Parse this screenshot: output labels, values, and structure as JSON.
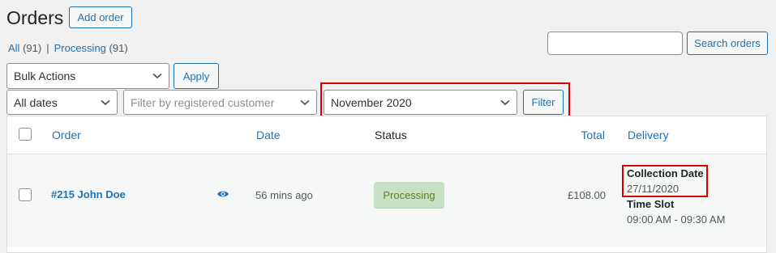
{
  "header": {
    "title": "Orders",
    "add_order_label": "Add order"
  },
  "subsubsub": {
    "all_label": "All",
    "all_count": "(91)",
    "separator": "|",
    "processing_label": "Processing",
    "processing_count": "(91)"
  },
  "search": {
    "value": "",
    "button_label": "Search orders"
  },
  "bulk_actions": {
    "selected": "Bulk Actions",
    "apply_label": "Apply"
  },
  "filters": {
    "dates_selected": "All dates",
    "customer_placeholder": "Filter by registered customer",
    "month_selected": "November 2020",
    "filter_label": "Filter"
  },
  "table": {
    "columns": {
      "order": "Order",
      "date": "Date",
      "status": "Status",
      "total": "Total",
      "delivery": "Delivery"
    },
    "rows": [
      {
        "order": "#215 John Doe",
        "date": "56 mins ago",
        "status": "Processing",
        "total": "£108.00",
        "delivery": {
          "collection_label": "Collection Date",
          "collection_value": "27/11/2020",
          "timeslot_label": "Time Slot",
          "timeslot_value": "09:00 AM - 09:30 AM"
        }
      }
    ]
  },
  "colors": {
    "link": "#2271b1",
    "highlight": "#d90000",
    "status_processing_bg": "#c6e1c6",
    "status_processing_text": "#5b841b"
  },
  "icons": {
    "chevron": "chevron-down-icon",
    "preview": "eye-icon"
  }
}
